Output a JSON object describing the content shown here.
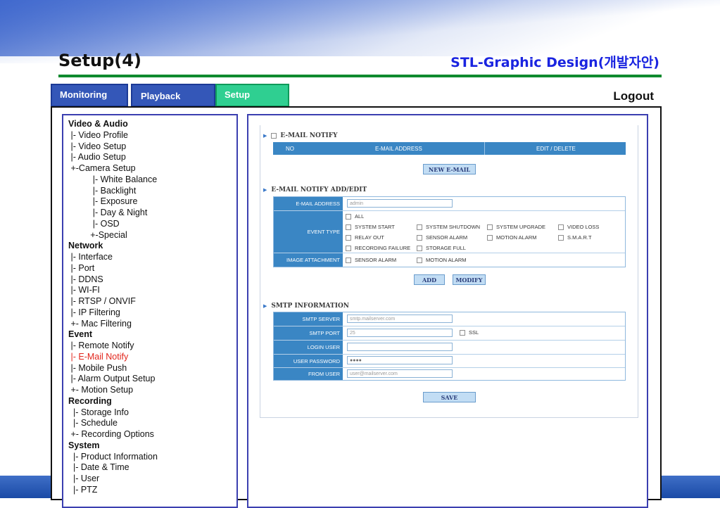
{
  "slide": {
    "title": "Setup(4)",
    "subtitle": "STL-Graphic Design(개발자안)"
  },
  "tabs": [
    {
      "label": "Monitoring",
      "active": false
    },
    {
      "label": "Playback",
      "active": false
    },
    {
      "label": "Setup",
      "active": true
    }
  ],
  "logout_label": "Logout",
  "sidebar": [
    {
      "text": "Video & Audio",
      "type": "head"
    },
    {
      "text": " |- Video Profile",
      "type": "item"
    },
    {
      "text": " |- Video Setup",
      "type": "item"
    },
    {
      "text": " |- Audio Setup",
      "type": "item"
    },
    {
      "text": " +-Camera Setup",
      "type": "item"
    },
    {
      "text": "          |- White Balance",
      "type": "item"
    },
    {
      "text": "          |- Backlight",
      "type": "item"
    },
    {
      "text": "          |- Exposure",
      "type": "item"
    },
    {
      "text": "          |- Day & Night",
      "type": "item"
    },
    {
      "text": "          |- OSD",
      "type": "item"
    },
    {
      "text": "         +-Special",
      "type": "item"
    },
    {
      "text": "Network",
      "type": "head"
    },
    {
      "text": " |- Interface",
      "type": "item"
    },
    {
      "text": " |- Port",
      "type": "item"
    },
    {
      "text": " |- DDNS",
      "type": "item"
    },
    {
      "text": " |- WI-FI",
      "type": "item"
    },
    {
      "text": " |- RTSP / ONVIF",
      "type": "item"
    },
    {
      "text": " |- IP Filtering",
      "type": "item"
    },
    {
      "text": " +- Mac Filtering",
      "type": "item"
    },
    {
      "text": "Event",
      "type": "head"
    },
    {
      "text": " |- Remote Notify",
      "type": "item"
    },
    {
      "text": " |- E-Mail Notify",
      "type": "active"
    },
    {
      "text": " |- Mobile Push",
      "type": "item"
    },
    {
      "text": " |- Alarm Output Setup",
      "type": "item"
    },
    {
      "text": " +- Motion Setup",
      "type": "item"
    },
    {
      "text": "Recording",
      "type": "head"
    },
    {
      "text": "  |- Storage Info",
      "type": "item"
    },
    {
      "text": "  |- Schedule",
      "type": "item"
    },
    {
      "text": " +- Recording Options",
      "type": "item"
    },
    {
      "text": "System",
      "type": "head"
    },
    {
      "text": "  |- Product Information",
      "type": "item"
    },
    {
      "text": "  |- Date & Time",
      "type": "item"
    },
    {
      "text": "  |- User",
      "type": "item"
    },
    {
      "text": "  |- PTZ",
      "type": "item"
    }
  ],
  "email_notify": {
    "section_label": "E-MAIL NOTIFY",
    "columns": [
      "NO",
      "E-MAIL ADDRESS",
      "EDIT / DELETE"
    ],
    "new_button": "NEW E-MAIL"
  },
  "add_edit": {
    "section_label": "E-MAIL NOTIFY ADD/EDIT",
    "email_label": "E-MAIL ADDRESS",
    "email_value": "admin",
    "event_type_label": "EVENT TYPE",
    "event_types": [
      "ALL",
      "SYSTEM START",
      "SYSTEM SHUTDOWN",
      "SYSTEM UPGRADE",
      "VIDEO LOSS",
      "RELAY OUT",
      "SENSOR ALARM",
      "MOTION ALARM",
      "S.M.A.R.T",
      "RECORDING FAILURE",
      "STORAGE FULL"
    ],
    "image_attachment_label": "IMAGE ATTACHMENT",
    "attachments": [
      "SENSOR ALARM",
      "MOTION ALARM"
    ],
    "add_button": "ADD",
    "modify_button": "MODIFY"
  },
  "smtp": {
    "section_label": "SMTP INFORMATION",
    "server_label": "SMTP SERVER",
    "server_value": "smtp.mailserver.com",
    "port_label": "SMTP PORT",
    "port_value": "25",
    "ssl_label": "SSL",
    "login_label": "LOGIN USER",
    "login_value": "",
    "password_label": "USER PASSWORD",
    "password_value": "●●●●",
    "from_label": "FROM USER",
    "from_value": "user@mailserver.com",
    "save_button": "SAVE"
  },
  "colors": {
    "tab_blue": "#3457b8",
    "tab_active": "#2fcf91",
    "header_blue": "#3a86c4",
    "title_blue": "#1a24e0",
    "rule_green": "#0f8a2e",
    "active_item": "#e2261c"
  }
}
